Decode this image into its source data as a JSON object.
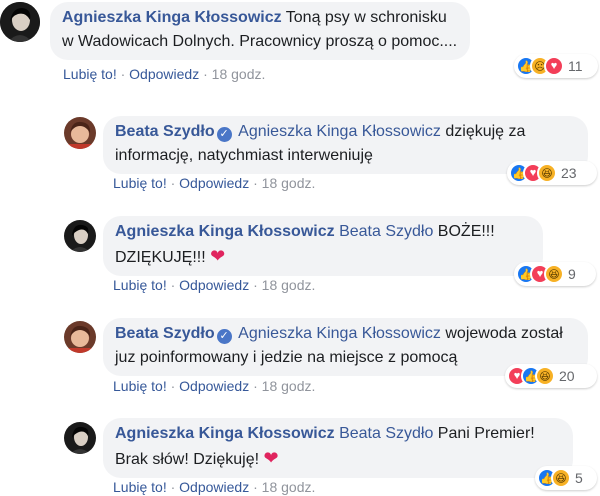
{
  "actions": {
    "like": "Lubię to!",
    "reply": "Odpowiedz",
    "time": "18 godz."
  },
  "comments": [
    {
      "author": "Agnieszka Kinga Kłossowicz",
      "mention": "",
      "text": "Toną psy w schronisku w Wadowicach Dolnych. Pracownicy proszą o pomoc....",
      "reaction_count": "11",
      "reactions": [
        "like-icon",
        "sad-icon",
        "love-icon"
      ]
    },
    {
      "author": "Beata Szydło",
      "mention": "Agnieszka Kinga Kłossowicz",
      "text": "dziękuję za informację, natychmiast interweniuję",
      "reaction_count": "23",
      "reactions": [
        "like-icon",
        "love-icon",
        "haha-icon"
      ]
    },
    {
      "author": "Agnieszka Kinga Kłossowicz",
      "mention": "Beata Szydło",
      "text": "BOŻE!!! DZIĘKUJĘ!!!",
      "reaction_count": "9",
      "reactions": [
        "like-icon",
        "love-icon",
        "haha-icon"
      ]
    },
    {
      "author": "Beata Szydło",
      "mention": "Agnieszka Kinga Kłossowicz",
      "text": "wojewoda został juz poinformowany i jedzie na miejsce z pomocą",
      "reaction_count": "20",
      "reactions": [
        "love-icon",
        "like-icon",
        "haha-icon"
      ]
    },
    {
      "author": "Agnieszka Kinga Kłossowicz",
      "mention": "Beata Szydło",
      "text": "Pani Premier! Brak słów! Dziękuję!",
      "reaction_count": "5",
      "reactions": [
        "like-icon",
        "haha-icon"
      ]
    }
  ],
  "colors": {
    "author": "#385898",
    "bubble": "#f2f3f5",
    "like": "#1877f2",
    "love": "#f33e58",
    "haha": "#f7b125"
  }
}
